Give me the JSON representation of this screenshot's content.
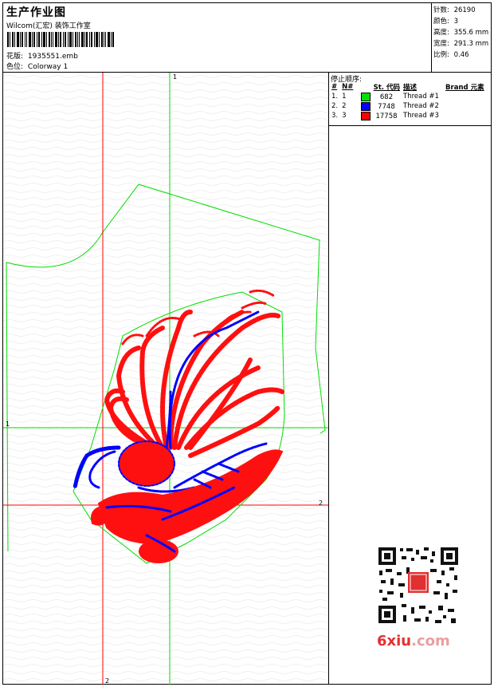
{
  "header": {
    "title": "生产作业图",
    "company": "Wilcom(汇宏) 装饰工作室",
    "design_label": "花版:",
    "design_value": "1935551.emb",
    "colorway_label": "色位:",
    "colorway_value": "Colorway 1"
  },
  "stats": {
    "stitches_label": "针数:",
    "stitches_value": "26190",
    "colors_label": "颜色:",
    "colors_value": "3",
    "height_label": "高度:",
    "height_value": "355.6 mm",
    "width_label": "宽度:",
    "width_value": "291.3 mm",
    "scale_label": "比例:",
    "scale_value": "0.46"
  },
  "stop_sequence": {
    "title": "停止顺序:",
    "headers": [
      "#",
      "N#",
      "St.",
      "代码",
      "描述",
      "Brand",
      "元素"
    ],
    "rows": [
      {
        "index": "1.",
        "needle": "1",
        "color": "#00e000",
        "stitches": "682",
        "desc": "Thread #1"
      },
      {
        "index": "2.",
        "needle": "2",
        "color": "#0000ff",
        "stitches": "7748",
        "desc": "Thread #2"
      },
      {
        "index": "3.",
        "needle": "3",
        "color": "#ff0000",
        "stitches": "17758",
        "desc": "Thread #3"
      }
    ]
  },
  "canvas": {
    "marker_v1": "1",
    "marker_h1": "1",
    "marker_h2": "2",
    "marker_v2": "2",
    "colors": {
      "guide": "#00dd00",
      "red_guide": "#ff0000",
      "blue": "#0000ff",
      "red": "#ff0000"
    }
  },
  "watermark": {
    "text_a": "6xiu",
    "text_b": ".com"
  }
}
